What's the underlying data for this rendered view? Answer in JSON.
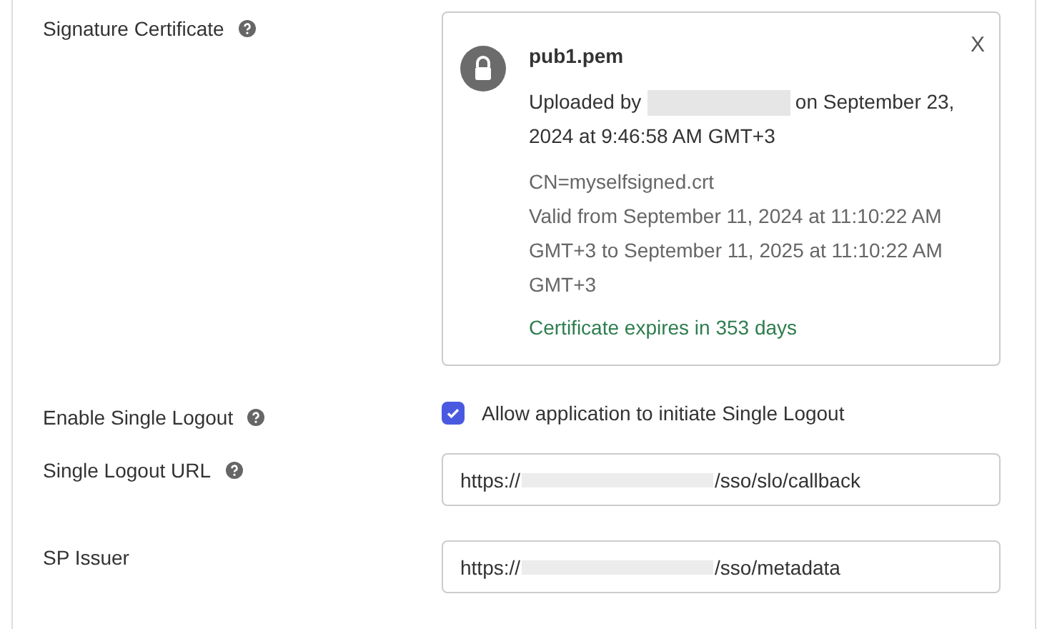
{
  "certificate": {
    "label": "Signature Certificate",
    "help": true,
    "file_name": "pub1.pem",
    "close": "X",
    "uploaded_prefix": "Uploaded by",
    "uploaded_suffix": "on September 23, 2024 at 9:46:58 AM GMT+3",
    "details": [
      "CN=myselfsigned.crt",
      "Valid from September 11, 2024 at 11:10:22 AM GMT+3 to September 11, 2025 at 11:10:22 AM GMT+3"
    ],
    "expiry": "Certificate expires in 353 days"
  },
  "single_logout": {
    "label": "Enable Single Logout",
    "help": true,
    "checked": true,
    "option": "Allow application to initiate Single Logout"
  },
  "fields": [
    {
      "label": "Single Logout URL",
      "help": true,
      "value_prefix": "https://",
      "value_suffix": "/sso/slo/callback"
    },
    {
      "label": "SP Issuer",
      "help": false,
      "value_prefix": "https://",
      "value_suffix": "/sso/metadata"
    }
  ]
}
